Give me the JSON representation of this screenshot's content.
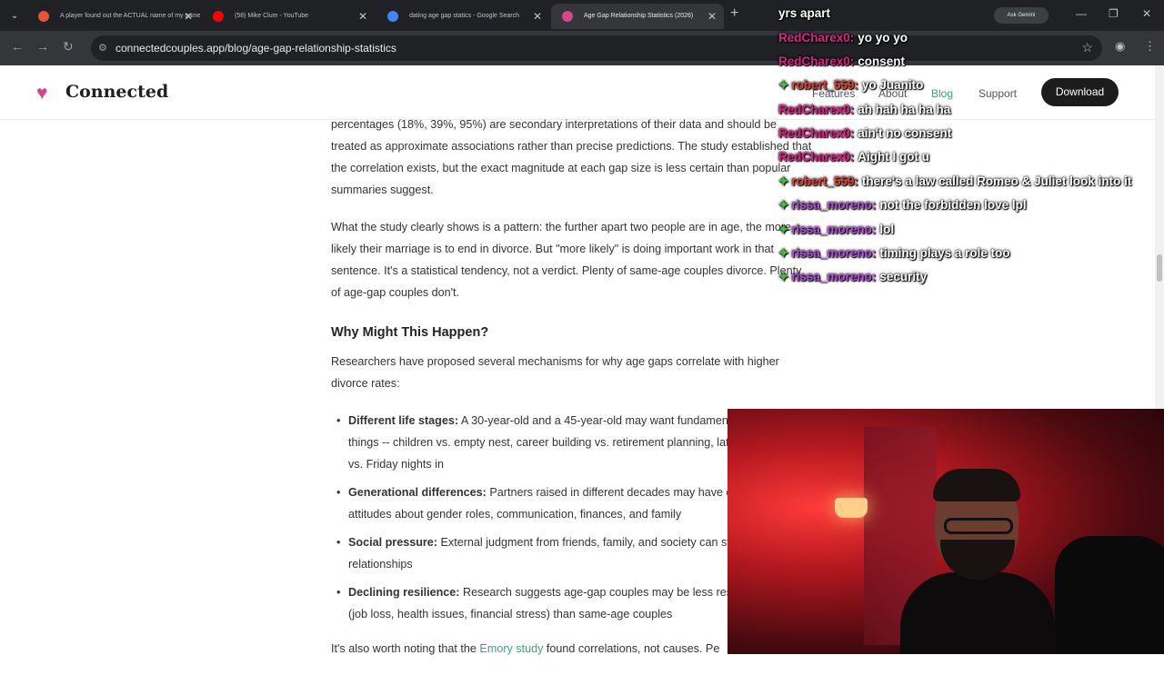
{
  "browser": {
    "tabs": [
      {
        "title": "A player found out the ACTUAL name of my game's sp",
        "icon_color": "#e6523a",
        "active": false
      },
      {
        "title": "(58) Mike Clum - YouTube",
        "icon_color": "#ff0000",
        "active": false
      },
      {
        "title": "dating age gap statics - Google Search",
        "icon_color": "#4285f4",
        "active": false
      },
      {
        "title": "Age Gap Relationship Statistics (2026)",
        "icon_color": "#d6478a",
        "active": true
      }
    ],
    "new_tab": "+",
    "ask_gemini": "Ask Gemini",
    "url": "connectedcouples.app/blog/age-gap-relationship-statistics"
  },
  "site": {
    "brand": "Connected",
    "nav": [
      "Features",
      "About",
      "Blog",
      "Support"
    ],
    "active_nav": "Blog",
    "download_label": "Download"
  },
  "article": {
    "para1": "percentages (18%, 39%, 95%) are secondary interpretations of their data and should be treated as approximate associations rather than precise predictions. The study established that the correlation exists, but the exact magnitude at each gap size is less certain than popular summaries suggest.",
    "para2": "What the study clearly shows is a pattern: the further apart two people are in age, the more likely their marriage is to end in divorce. But \"more likely\" is doing important work in that sentence. It's a statistical tendency, not a verdict. Plenty of same-age couples divorce. Plenty of age-gap couples don't.",
    "heading": "Why Might This Happen?",
    "para3": "Researchers have proposed several mechanisms for why age gaps correlate with higher divorce rates:",
    "bullets": [
      {
        "term": "Different life stages:",
        "text": " A 30-year-old and a 45-year-old may want fundamentally different things -- children vs. empty nest, career building vs. retirement planning, late-night outings vs. Friday nights in"
      },
      {
        "term": "Generational differences:",
        "text": " Partners raised in different decades may have different attitudes about gender roles, communication, finances, and family"
      },
      {
        "term": "Social pressure:",
        "text": " External judgment from friends, family, and society can strain relationships"
      },
      {
        "term": "Declining resilience:",
        "text": " Research suggests age-gap couples may be less resilient to shocks (job loss, health issues, financial stress) than same-age couples"
      }
    ],
    "para4_start": "It's also worth noting that the ",
    "para4_link": "Emory study",
    "para4_end": " found correlations, not causes. Pe"
  },
  "chat": [
    {
      "user": "",
      "text": "yrs apart",
      "color": "#ffffff",
      "badge": false
    },
    {
      "user": "RedCharex0:",
      "text": "yo yo yo",
      "color": "#e0218a",
      "badge": false
    },
    {
      "user": "RedCharex0:",
      "text": "consent",
      "color": "#e0218a",
      "badge": false
    },
    {
      "user": "robert_559:",
      "text": "yo Juanito",
      "color": "#e34234",
      "badge": true
    },
    {
      "user": "RedCharex0:",
      "text": "ah hah ha ha ha",
      "color": "#e0218a",
      "badge": false
    },
    {
      "user": "RedCharex0:",
      "text": "ain't no consent",
      "color": "#e0218a",
      "badge": false
    },
    {
      "user": "RedCharex0:",
      "text": "Aight I got u",
      "color": "#e0218a",
      "badge": false
    },
    {
      "user": "robert_559:",
      "text": "there's a law called Romeo & Juliet look into it",
      "color": "#e34234",
      "badge": true
    },
    {
      "user": "rissa_moreno:",
      "text": "not the forbidden love lpl",
      "color": "#b04fd6",
      "badge": true
    },
    {
      "user": "rissa_moreno:",
      "text": "lol",
      "color": "#b04fd6",
      "badge": true
    },
    {
      "user": "rissa_moreno:",
      "text": "timing plays a role too",
      "color": "#b04fd6",
      "badge": true
    },
    {
      "user": "rissa_moreno:",
      "text": "security",
      "color": "#b04fd6",
      "badge": true
    }
  ]
}
